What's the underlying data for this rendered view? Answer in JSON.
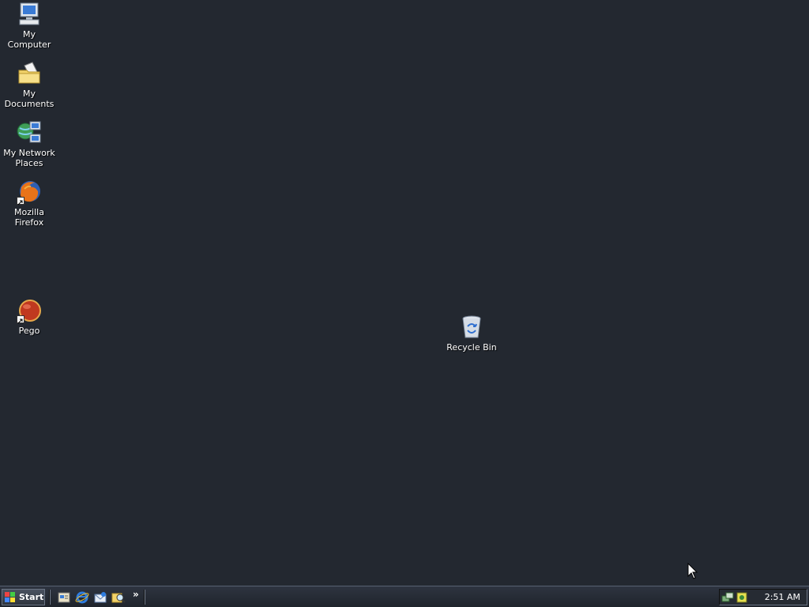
{
  "desktop": {
    "background_color": "#232830",
    "icons": [
      {
        "label": "My Computer",
        "icon": "my-computer-icon"
      },
      {
        "label": "My Documents",
        "icon": "my-documents-icon"
      },
      {
        "label": "My Network Places",
        "icon": "network-places-icon"
      },
      {
        "label": "Mozilla Firefox",
        "icon": "firefox-icon"
      },
      {
        "label": "Pego",
        "icon": "pego-icon"
      },
      {
        "label": "Recycle Bin",
        "icon": "recycle-bin-icon"
      }
    ]
  },
  "taskbar": {
    "start_label": "Start",
    "quick_launch": [
      {
        "icon": "show-desktop-icon"
      },
      {
        "icon": "internet-explorer-icon"
      },
      {
        "icon": "outlook-express-icon"
      },
      {
        "icon": "search-icon"
      }
    ],
    "overflow_label": "»",
    "tray_icons": [
      {
        "icon": "network-tray-icon"
      },
      {
        "icon": "security-tray-icon"
      }
    ],
    "clock": "2:51 AM"
  }
}
